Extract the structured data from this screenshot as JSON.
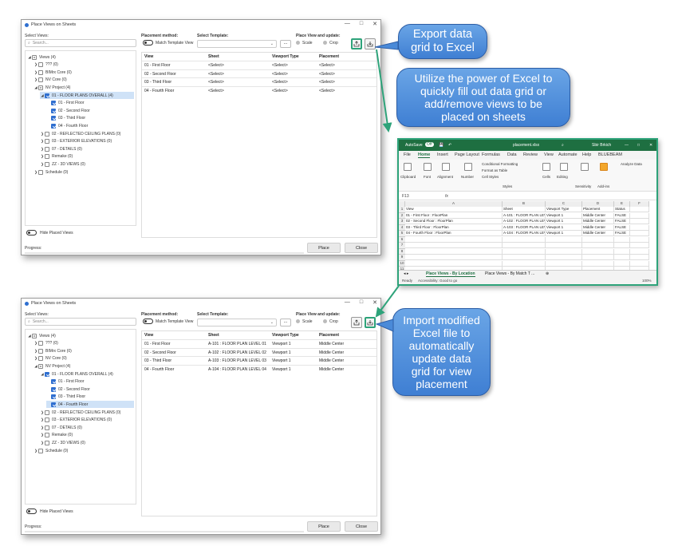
{
  "dialog": {
    "title": "Place Views on Sheets",
    "select_views_label": "Select Views:",
    "search_placeholder": "Search...",
    "placement_method_label": "Placement method:",
    "match_template_label": "Match Template View",
    "select_template_label": "Select Template:",
    "template_dots": "...",
    "place_view_update_label": "Place View and update:",
    "scale_label": "Scale",
    "crop_label": "Crop",
    "hide_placed_label": "Hide Placed Views",
    "progress_label": "Progress:",
    "place_button": "Place",
    "close_button": "Close",
    "columns": [
      "View",
      "Sheet",
      "Viewport Type",
      "Placement"
    ],
    "tree": [
      {
        "label": "Views (4)",
        "indent": 0,
        "caret": "open",
        "check": "part"
      },
      {
        "label": "??? (0)",
        "indent": 1,
        "caret": "closed",
        "check": "off"
      },
      {
        "label": "BIMrx Core (0)",
        "indent": 1,
        "caret": "closed",
        "check": "off"
      },
      {
        "label": "NV Core (0)",
        "indent": 1,
        "caret": "closed",
        "check": "off"
      },
      {
        "label": "NV Project (4)",
        "indent": 1,
        "caret": "open",
        "check": "part"
      },
      {
        "label": "01 - FLOOR PLANS OVERALL (4)",
        "indent": 2,
        "caret": "open",
        "check": "on",
        "sel": true
      },
      {
        "label": "01 - First Floor",
        "indent": 3,
        "caret": "",
        "check": "on"
      },
      {
        "label": "02 - Second Floor",
        "indent": 3,
        "caret": "",
        "check": "on"
      },
      {
        "label": "03 - Third Floor",
        "indent": 3,
        "caret": "",
        "check": "on"
      },
      {
        "label": "04 - Fourth Floor",
        "indent": 3,
        "caret": "",
        "check": "on"
      },
      {
        "label": "02 - REFLECTED CEILING PLANS (0)",
        "indent": 2,
        "caret": "closed",
        "check": "off"
      },
      {
        "label": "03 - EXTERIOR ELEVATIONS (0)",
        "indent": 2,
        "caret": "closed",
        "check": "off"
      },
      {
        "label": "07 - DETAILS (0)",
        "indent": 2,
        "caret": "closed",
        "check": "off"
      },
      {
        "label": "Remake (0)",
        "indent": 2,
        "caret": "closed",
        "check": "off"
      },
      {
        "label": "ZZ - 3D VIEWS (0)",
        "indent": 2,
        "caret": "closed",
        "check": "off"
      },
      {
        "label": "Schedule (0)",
        "indent": 1,
        "caret": "closed",
        "check": "off"
      }
    ]
  },
  "top_rows": [
    [
      "01 - First Floor",
      "<Select>",
      "<Select>",
      "<Select>"
    ],
    [
      "02 - Second Floor",
      "<Select>",
      "<Select>",
      "<Select>"
    ],
    [
      "03 - Third Floor",
      "<Select>",
      "<Select>",
      "<Select>"
    ],
    [
      "04 - Fourth Floor",
      "<Select>",
      "<Select>",
      "<Select>"
    ]
  ],
  "bottom_rows": [
    [
      "01 - First Floor",
      "A-101 : FLOOR PLAN LEVEL 01",
      "Viewport 1",
      "Middle Center"
    ],
    [
      "02 - Second Floor",
      "A-102 : FLOOR PLAN LEVEL 02",
      "Viewport 1",
      "Middle Center"
    ],
    [
      "03 - Third Floor",
      "A-103 : FLOOR PLAN LEVEL 03",
      "Viewport 1",
      "Middle Center"
    ],
    [
      "04 - Fourth Floor",
      "A-104 : FLOOR PLAN LEVEL 04",
      "Viewport 1",
      "Middle Center"
    ]
  ],
  "callouts": {
    "export": [
      "Export data",
      "grid to Excel"
    ],
    "excel": [
      "Utilize the power of Excel to",
      "quickly fill out data grid or",
      "add/remove views to be",
      "placed on sheets"
    ],
    "import": [
      "Import modified",
      "Excel file to",
      "automatically",
      "update data",
      "grid for view",
      "placement"
    ]
  },
  "excel": {
    "autosave": "AutoSave",
    "autosave_state": "Off",
    "filename": "placement.xlsx",
    "user": "Sbir Brkich",
    "menu": [
      "File",
      "Home",
      "Insert",
      "Page Layout",
      "Formulas",
      "Data",
      "Review",
      "View",
      "Automate",
      "Help",
      "BLUEBEAM"
    ],
    "ribbon": {
      "clipboard": "Clipboard",
      "font": "Font",
      "alignment": "Alignment",
      "number": "Number",
      "cond_format": "Conditional Formatting",
      "format_table": "Format as Table",
      "cell_styles": "Cell Styles",
      "styles": "Styles",
      "cells": "Cells",
      "editing": "Editing",
      "sensitivity": "Sensitivity",
      "addins": "Add-ins",
      "analyze": "Analyze Data"
    },
    "cell_ref": "F13",
    "fx": "fx",
    "columns": [
      "A",
      "B",
      "C",
      "D",
      "E",
      "F"
    ],
    "rows": [
      [
        "View",
        "Sheet",
        "Viewport Type",
        "Placement",
        "Status"
      ],
      [
        "01 - First Floor : FloorPlan",
        "A-101 : FLOOR PLAN LEVEL 01",
        "Viewport 1",
        "Middle Center",
        "FALSE"
      ],
      [
        "02 - Second Floor : FloorPlan",
        "A-102 : FLOOR PLAN LEVEL 02",
        "Viewport 1",
        "Middle Center",
        "FALSE"
      ],
      [
        "03 - Third Floor : FloorPlan",
        "A-103 : FLOOR PLAN LEVEL 03",
        "Viewport 1",
        "Middle Center",
        "FALSE"
      ],
      [
        "04 - Fourth Floor : FloorPlan",
        "A-104 : FLOOR PLAN LEVEL 04",
        "Viewport 1",
        "Middle Center",
        "FALSE"
      ]
    ],
    "tab_active": "Place Views - By Location",
    "tab_other": "Place Views - By Match T ...",
    "status_ready": "Ready",
    "status_access": "Accessibility: Good to go",
    "zoom": "100%"
  },
  "colors": {
    "accent_green": "#2ea37a",
    "callout_blue": "#4a8ad8",
    "excel_green": "#1e6f41"
  }
}
